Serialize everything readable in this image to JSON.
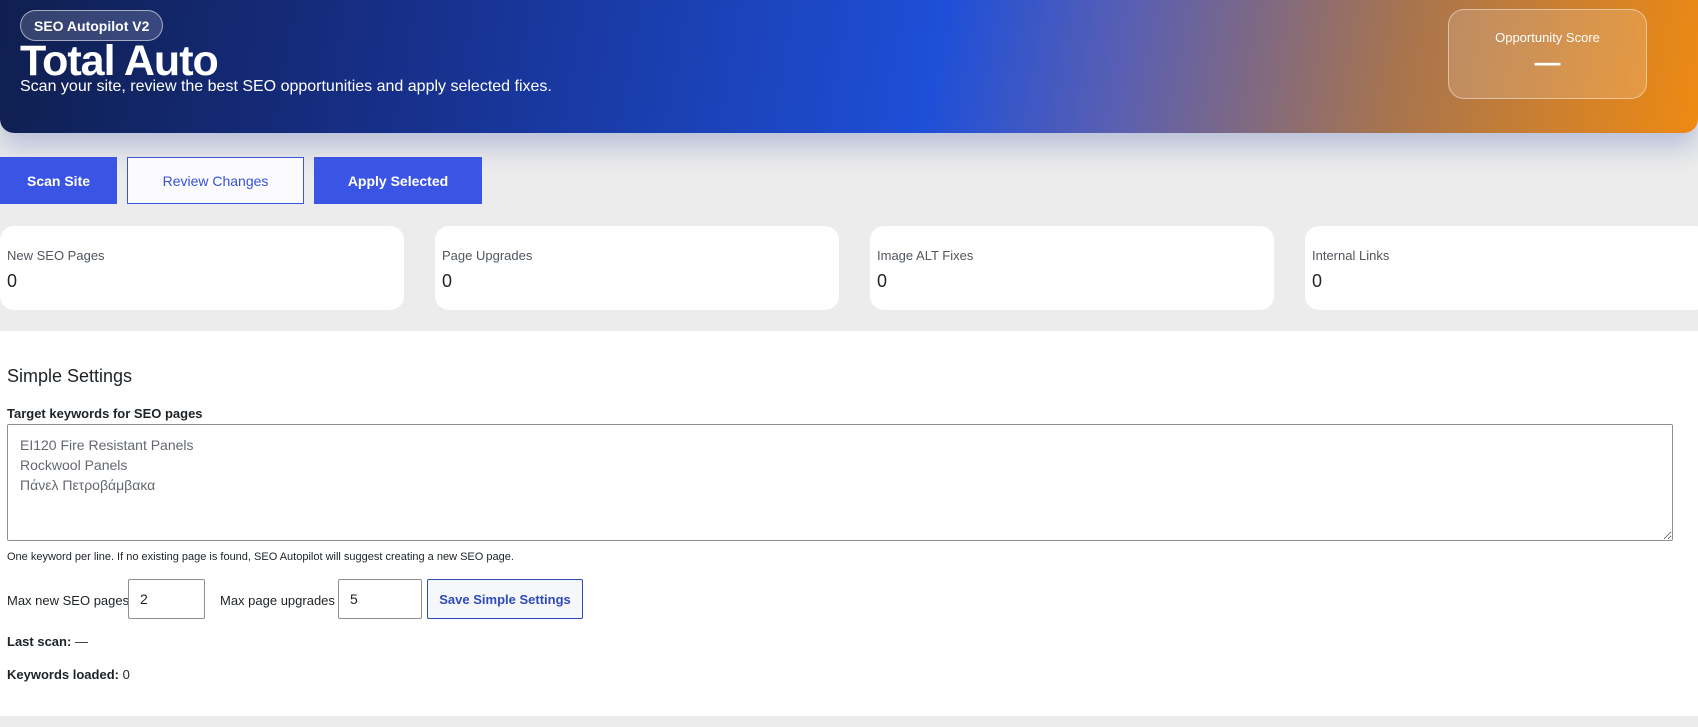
{
  "header": {
    "badge": "SEO Autopilot V2",
    "title": "Total Auto",
    "subtitle": "Scan your site, review the best SEO opportunities and apply selected fixes.",
    "score_label": "Opportunity Score",
    "score_value": "—"
  },
  "actions": {
    "scan": "Scan Site",
    "review": "Review Changes",
    "apply": "Apply Selected"
  },
  "stats": [
    {
      "label": "New SEO Pages",
      "value": "0"
    },
    {
      "label": "Page Upgrades",
      "value": "0"
    },
    {
      "label": "Image ALT Fixes",
      "value": "0"
    },
    {
      "label": "Internal Links",
      "value": "0"
    }
  ],
  "settings": {
    "title": "Simple Settings",
    "keywords_label": "Target keywords for SEO pages",
    "keywords_value": "EI120 Fire Resistant Panels\nRockwool Panels\nΠάνελ Πετροβάμβακα",
    "keywords_help": "One keyword per line. If no existing page is found, SEO Autopilot will suggest creating a new SEO page.",
    "max_new_label": "Max new SEO pages",
    "max_new_value": "2",
    "max_upgrades_label": "Max page upgrades",
    "max_upgrades_value": "5",
    "save_label": "Save Simple Settings",
    "last_scan_label": "Last scan:",
    "last_scan_value": "—",
    "keywords_loaded_label": "Keywords loaded:",
    "keywords_loaded_value": "0"
  }
}
